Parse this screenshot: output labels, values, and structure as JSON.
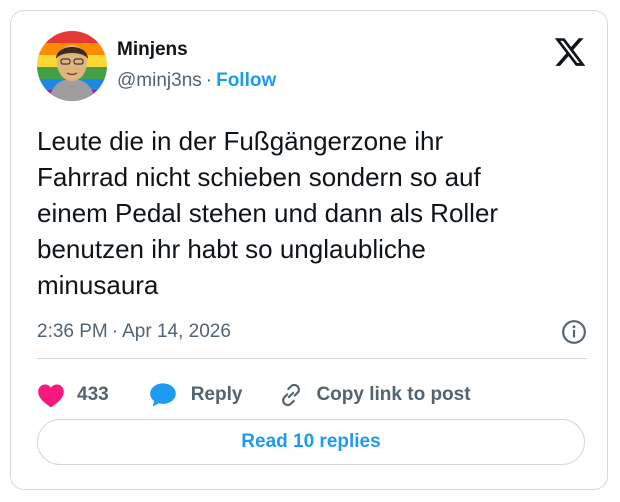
{
  "author": {
    "display_name": "Minjens",
    "handle": "@minj3ns",
    "separator": "·",
    "follow_label": "Follow"
  },
  "tweet": {
    "text": "Leute die in der Fußgängerzone ihr\nFahrrad nicht schieben sondern so auf\neinem Pedal stehen und dann als Roller\nbenutzen ihr habt so unglaubliche\nminusaura",
    "time": "2:36 PM",
    "separator": "·",
    "date": "Apr 14, 2026"
  },
  "actions": {
    "like_count": "433",
    "reply_label": "Reply",
    "copy_label": "Copy link to post"
  },
  "footer": {
    "read_replies_label": "Read 10 replies"
  },
  "colors": {
    "accent": "#1d9bf0",
    "like": "#f91880",
    "text": "#0f1419",
    "secondary": "#536471",
    "border": "#cfd9de"
  },
  "icons": {
    "brand": "x-logo-icon",
    "info": "info-icon",
    "like": "heart-icon",
    "reply": "speech-bubble-icon",
    "copy": "link-icon"
  }
}
